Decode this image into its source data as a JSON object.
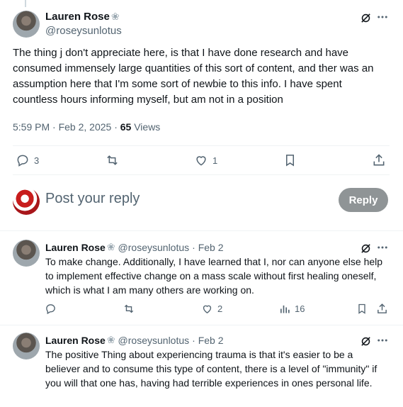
{
  "main_post": {
    "author_name": "Lauren Rose",
    "handle": "@roseysunlotus",
    "text": "The thing j don't appreciate here, is that I have done research and have consumed immensely large quantities of this sort of content, and ther was an assumption here that I'm some sort of newbie to this info. I have spent countless hours informing myself, but am not in a position",
    "time": "5:59 PM · Feb 2, 2025 · ",
    "views": "65",
    "views_label": " Views",
    "reply_count": "3",
    "repost_count": "",
    "like_count": "1"
  },
  "reply_composer": {
    "placeholder": "Post your reply",
    "button_label": "Reply"
  },
  "replies": [
    {
      "author_name": "Lauren Rose",
      "handle": "@roseysunlotus",
      "date": "· Feb 2",
      "text": "To make change. Additionally, I have learned that I, nor can anyone else help to implement effective change on a mass scale without first healing oneself, which is what I am many others are working on.",
      "reply_count": "",
      "repost_count": "",
      "like_count": "2",
      "views": "16"
    },
    {
      "author_name": "Lauren Rose",
      "handle": "@roseysunlotus",
      "date": "· Feb 2",
      "text": "The positive Thing about experiencing trauma is that it's easier to be a believer and to consume this type of content, there is a level of \"immunity\" if you will that one has, having had terrible experiences in ones personal life."
    }
  ],
  "icons": {
    "badge": "lotus-badge-icon",
    "grok": "grok-icon",
    "more": "more-icon",
    "reply": "reply-icon",
    "repost": "repost-icon",
    "like": "like-icon",
    "bookmark": "bookmark-icon",
    "share": "share-icon",
    "views": "views-icon"
  }
}
